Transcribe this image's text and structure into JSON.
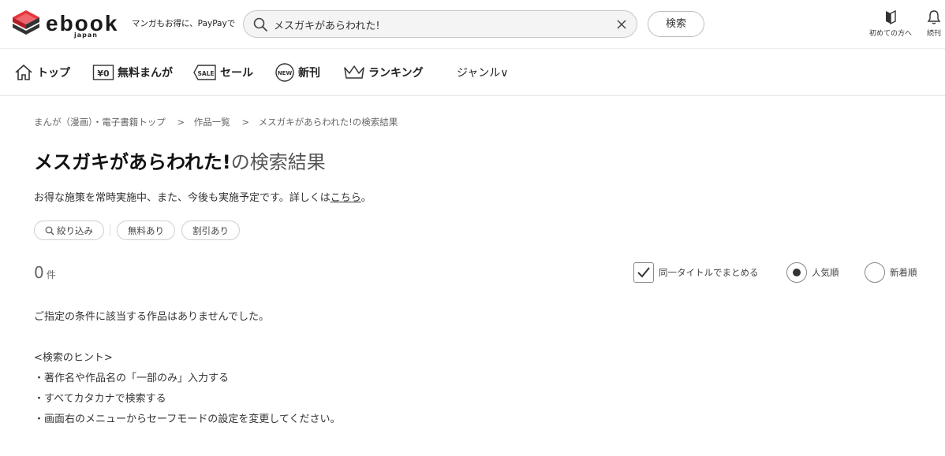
{
  "header": {
    "logo_text": "ebook",
    "logo_sub": "japan",
    "tagline": "マンガもお得に、PayPayで",
    "search_value": "メスガキがあらわれた!",
    "search_button": "検索",
    "link_first_time": "初めての方へ",
    "link_continued": "続刊",
    "brand_color": "#e8343c",
    "icons": [
      "book-logo-icon",
      "search-icon",
      "clear-icon",
      "book-guide-icon",
      "bell-icon"
    ]
  },
  "nav": {
    "items": [
      {
        "label": "トップ",
        "icon": "home-icon"
      },
      {
        "label": "無料まんが",
        "icon": "yen-zero-icon"
      },
      {
        "label": "セール",
        "icon": "sale-tag-icon"
      },
      {
        "label": "新刊",
        "icon": "new-badge-icon"
      },
      {
        "label": "ランキング",
        "icon": "crown-icon"
      }
    ],
    "genre": "ジャンル∨"
  },
  "breadcrumb": {
    "items": [
      "まんが（漫画）・電子書籍トップ",
      "作品一覧",
      "メスガキがあらわれた!の検索結果"
    ],
    "separator": ">"
  },
  "title": {
    "query": "メスガキがあらわれた!",
    "suffix": "の検索結果"
  },
  "notice": {
    "text": "お得な施策を常時実施中、また、今後も実施予定です。詳しくは",
    "link": "こちら",
    "end": "。"
  },
  "filters": {
    "narrow": "絞り込み",
    "free": "無料あり",
    "discount": "割引あり"
  },
  "results": {
    "count": "0",
    "unit": "件",
    "group_titles": {
      "label": "同一タイトルでまとめる",
      "checked": true
    },
    "sort_popular": {
      "label": "人気順",
      "selected": true
    },
    "sort_new": {
      "label": "新着順",
      "selected": false
    }
  },
  "message": {
    "none": "ご指定の条件に該当する作品はありませんでした。",
    "hint_title": "<検索のヒント>",
    "hints": [
      "・著作名や作品名の「一部のみ」入力する",
      "・すべてカタカナで検索する",
      "・画面右のメニューからセーフモードの設定を変更してください。"
    ]
  }
}
